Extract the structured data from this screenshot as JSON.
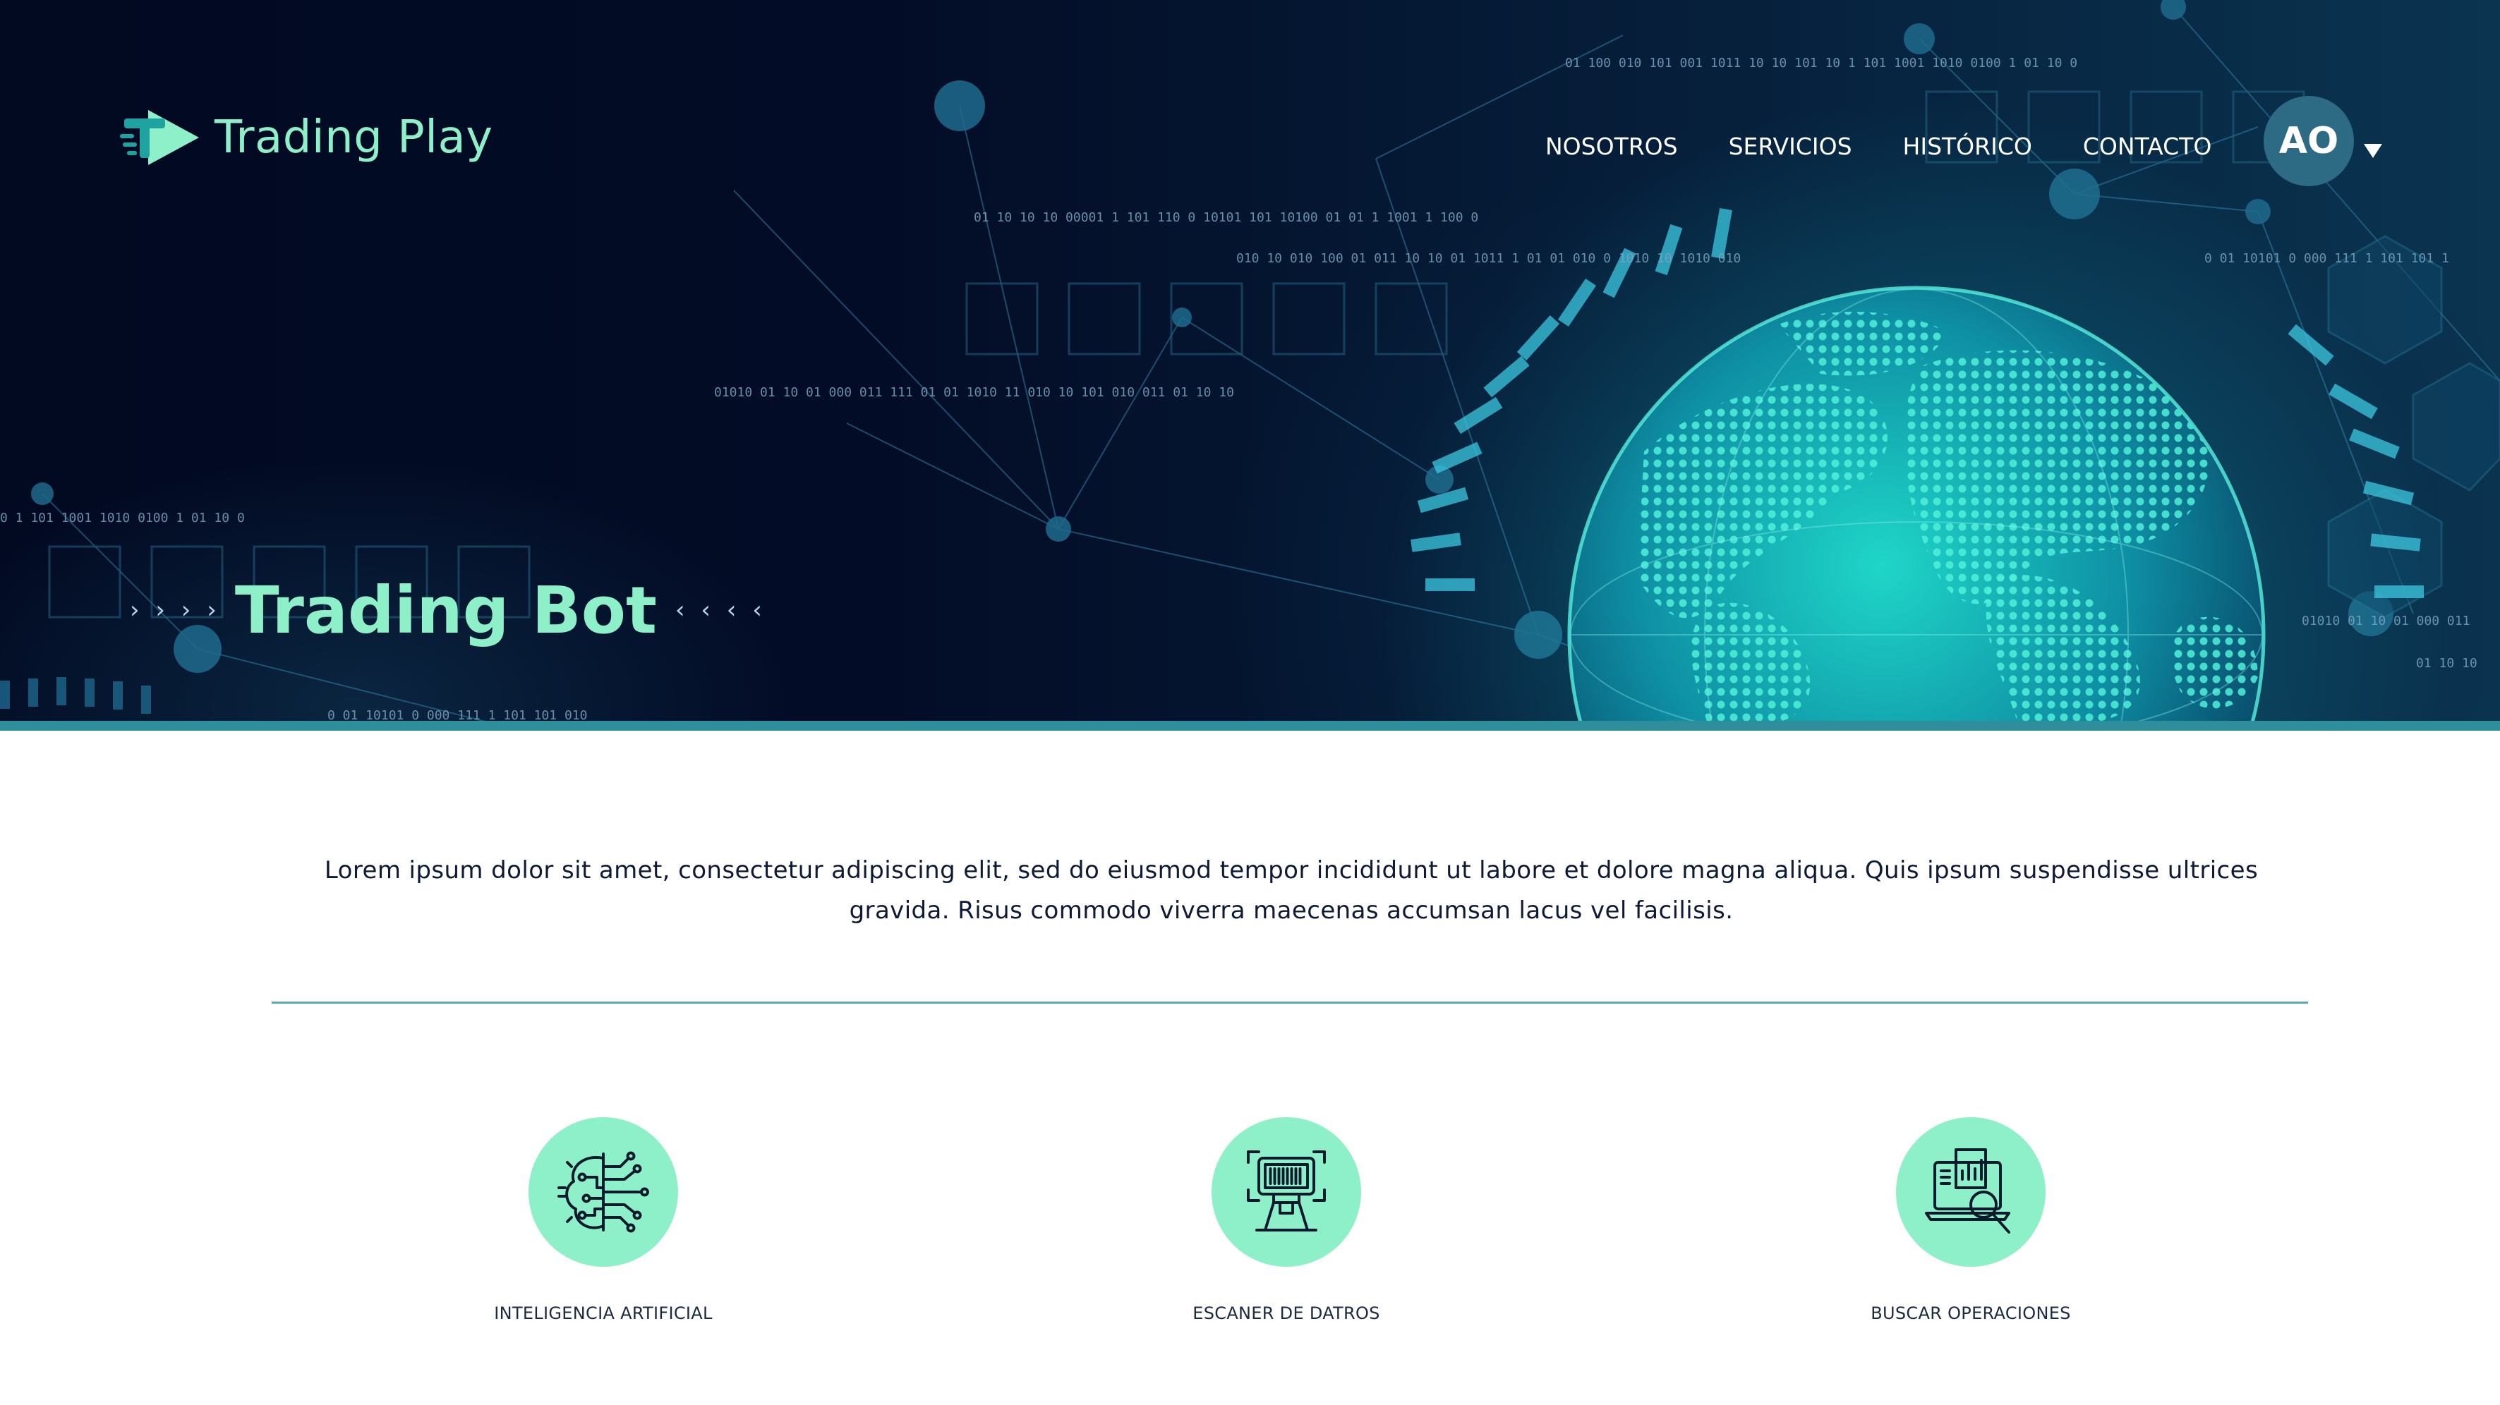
{
  "brand": {
    "name": "Trading Play",
    "logo_icon": "play-t-logo-icon"
  },
  "nav": {
    "items": [
      {
        "label": "NOSOTROS"
      },
      {
        "label": "SERVICIOS"
      },
      {
        "label": "HISTÓRICO"
      },
      {
        "label": "CONTACTO"
      }
    ]
  },
  "user": {
    "initials": "AO",
    "menu_icon": "caret-down-icon"
  },
  "hero": {
    "title": "Trading Bot",
    "left_decoration": "› › › ›",
    "right_decoration": "‹ ‹ ‹ ‹",
    "binary_lines": [
      "01 100 010   101   001     1011     10 10   101 10 1   101   1001     1010  0100 1 01 10   0",
      "01 10 10   10     00001 1 101 110 0     10101 101     10100   01   01     1   1001 1     100 0",
      "010     10 010   100     01   011     10     10 01 1011 1   01 01 010 0   1010 10     1010   010",
      "0 01   10101   0 000     111   1 101   101   1",
      "01010   01 10 01 000 011     111   01 01 1010     11   010 10     101   010     011 01 10 10",
      "0 1   101   1001     1010  0100 1 01 10   0",
      "01010   01 10 01 000 011",
      "01 10 10",
      "0 01   10101   0 000     111   1 101     101   010"
    ]
  },
  "intro": {
    "text": "Lorem ipsum dolor sit amet, consectetur adipiscing elit, sed do eiusmod tempor incididunt ut labore et dolore magna aliqua. Quis ipsum suspendisse ultrices gravida. Risus commodo viverra maecenas accumsan lacus vel facilisis."
  },
  "features": [
    {
      "label": "INTELIGENCIA ARTIFICIAL",
      "icon": "ai-brain-circuit-icon"
    },
    {
      "label": "ESCANER DE DATROS",
      "icon": "data-scanner-icon"
    },
    {
      "label": "BUSCAR OPERACIONES",
      "icon": "search-analytics-icon"
    }
  ],
  "colors": {
    "accent": "#8ef0c8",
    "hero_bg": "#030c26",
    "avatar_bg": "#2d6b84",
    "divider": "#5aaab5",
    "text_dark": "#0d1b38"
  }
}
